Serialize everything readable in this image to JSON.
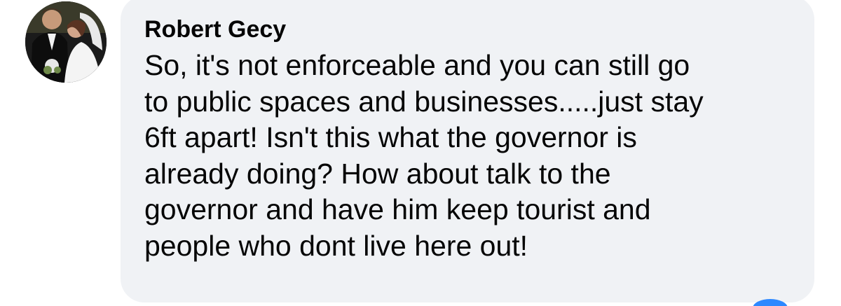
{
  "comment": {
    "author_name": "Robert Gecy",
    "text": "So, it's not enforceable and you can still go\nto public spaces and businesses.....just stay\n6ft apart! Isn't this what the governor is\nalready doing? How about talk to the\ngovernor and have him keep tourist and\npeople who dont live here out!"
  },
  "avatar": {
    "icon": "profile-photo-icon"
  },
  "colors": {
    "bubble_background": "#f0f2f5",
    "text": "#050505",
    "reaction_accent": "#2d88ff"
  }
}
